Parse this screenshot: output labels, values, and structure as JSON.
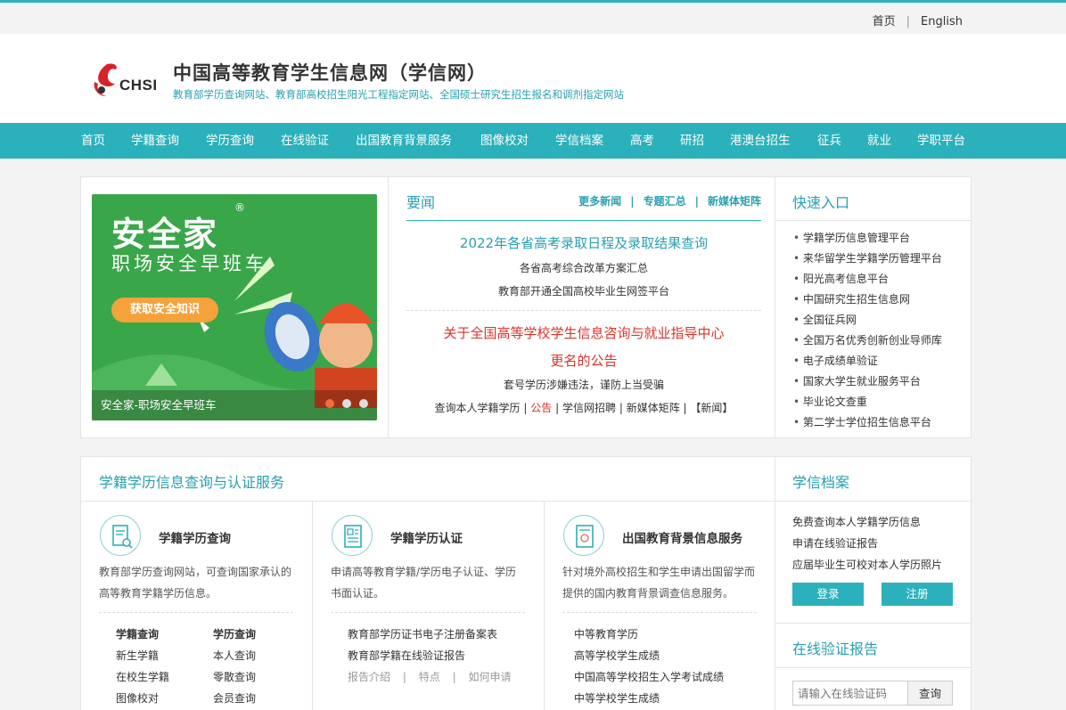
{
  "util": {
    "home": "首页",
    "english": "English",
    "sep": "|"
  },
  "header": {
    "logo_text": "CHSI",
    "title": "中国高等教育学生信息网（学信网）",
    "subtitle": "教育部学历查询网站、教育部高校招生阳光工程指定网站、全国硕士研究生招生报名和调剂指定网站"
  },
  "nav": [
    "首页",
    "学籍查询",
    "学历查询",
    "在线验证",
    "出国教育背景服务",
    "图像校对",
    "学信档案",
    "高考",
    "研招",
    "港澳台招生",
    "征兵",
    "就业",
    "学职平台"
  ],
  "banner": {
    "t1": "安全家",
    "reg": "®",
    "t2": "职场安全早班车",
    "button": "获取安全知识",
    "caption": "安全家-职场安全早班车"
  },
  "news": {
    "title": "要闻",
    "links": [
      "更多新闻",
      "专题汇总",
      "新媒体矩阵"
    ],
    "sep": "|",
    "headline1": "2022年各省高考录取日程及录取结果查询",
    "item1": "各省高考综合改革方案汇总",
    "item2": "教育部开通全国高校毕业生网签平台",
    "headline2a": "关于全国高等学校学生信息咨询与就业指导中心",
    "headline2b": "更名的公告",
    "item3": "套号学历涉嫌违法，谨防上当受骗",
    "bottom": {
      "a": "查询本人学籍学历",
      "b": "公告",
      "c": "学信网招聘",
      "d": "新媒体矩阵",
      "e": "【新闻】",
      "sep": "|"
    }
  },
  "quick": {
    "title": "快速入口",
    "items": [
      "学籍学历信息管理平台",
      "来华留学生学籍学历管理平台",
      "阳光高考信息平台",
      "中国研究生招生信息网",
      "全国征兵网",
      "全国万名优秀创新创业导师库",
      "电子成绩单验证",
      "国家大学生就业服务平台",
      "毕业论文查重",
      "第二学士学位招生信息平台"
    ]
  },
  "services": {
    "title": "学籍学历信息查询与认证服务",
    "s1": {
      "title": "学籍学历查询",
      "desc1": "教育部学历查询网站，可查询国家承认的",
      "desc2": "高等教育学籍学历信息。",
      "col1": [
        "学籍查询",
        "新生学籍",
        "在校生学籍",
        "图像校对"
      ],
      "col2": [
        "学历查询",
        "本人查询",
        "零散查询",
        "会员查询"
      ]
    },
    "s2": {
      "title": "学籍学历认证",
      "desc1": "申请高等教育学籍/学历电子认证、学历",
      "desc2": "书面认证。",
      "links": [
        "教育部学历证书电子注册备案表",
        "教育部学籍在线验证报告"
      ],
      "sub": [
        "报告介绍",
        "特点",
        "如何申请"
      ],
      "sep": "|"
    },
    "s3": {
      "title": "出国教育背景信息服务",
      "desc1": "针对境外高校招生和学生申请出国留学而",
      "desc2": "提供的国内教育背景调查信息服务。",
      "links": [
        "中等教育学历",
        "高等学校学生成绩",
        "中国高等学校招生入学考试成绩",
        "中等学校学生成绩"
      ]
    }
  },
  "archive": {
    "title": "学信档案",
    "lines": [
      "免费查询本人学籍学历信息",
      "申请在线验证报告",
      "应届毕业生可校对本人学历照片"
    ],
    "login": "登录",
    "register": "注册"
  },
  "verify": {
    "title": "在线验证报告",
    "placeholder": "请输入在线验证码",
    "button": "查询"
  }
}
